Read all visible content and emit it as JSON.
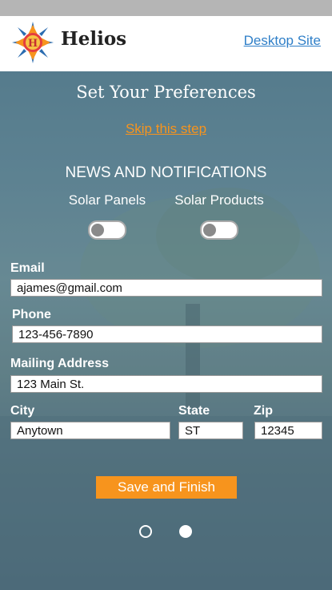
{
  "header": {
    "brand": "Helios",
    "desktop_link": "Desktop Site",
    "logo_letter": "H"
  },
  "main": {
    "title": "Set Your Preferences",
    "skip_link": "Skip this step",
    "section_heading": "NEWS AND NOTIFICATIONS",
    "options": [
      {
        "label": "Solar Panels"
      },
      {
        "label": "Solar Products"
      }
    ],
    "fields": {
      "email": {
        "label": "Email",
        "value": "ajames@gmail.com"
      },
      "phone": {
        "label": "Phone",
        "value": "123-456-7890"
      },
      "address": {
        "label": "Mailing Address",
        "value": "123 Main St."
      },
      "city": {
        "label": "City",
        "value": "Anytown"
      },
      "state": {
        "label": "State",
        "value": "ST"
      },
      "zip": {
        "label": "Zip",
        "value": "12345"
      }
    },
    "save_button": "Save and Finish"
  },
  "colors": {
    "accent": "#f7941d",
    "link": "#2f7fc8"
  }
}
